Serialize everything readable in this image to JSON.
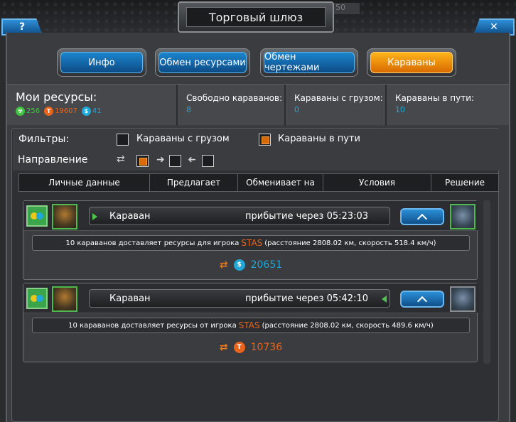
{
  "window": {
    "title": "Торговый шлюз",
    "clock": "50"
  },
  "buttons": {
    "help": "?",
    "close": "✕"
  },
  "tabs": [
    {
      "label": "Инфо",
      "active": false
    },
    {
      "label": "Обмен ресурсами",
      "active": false
    },
    {
      "label": "Обмен чертежами",
      "active": false
    },
    {
      "label": "Караваны",
      "active": true
    }
  ],
  "resources": {
    "title": "Мои ресурсы:",
    "items": [
      {
        "icon": "radiation-icon",
        "value": "256",
        "color": "#3fc23f"
      },
      {
        "icon": "titanium-icon",
        "value": "19607",
        "color": "#e8641c"
      },
      {
        "icon": "credits-icon",
        "value": "41",
        "color": "#1fa8d9"
      }
    ],
    "free_label": "Свободно караванов:",
    "free_value": "8",
    "loaded_label": "Караваны с грузом:",
    "loaded_value": "0",
    "transit_label": "Караваны в пути:",
    "transit_value": "10"
  },
  "filters": {
    "label": "Фильтры:",
    "loaded": {
      "label": "Караваны с грузом",
      "checked": false
    },
    "transit": {
      "label": "Караваны в пути",
      "checked": true
    },
    "direction_label": "Направление",
    "direction": {
      "both": true,
      "out": false,
      "in": false
    }
  },
  "table_headers": [
    "Личные данные",
    "Предлагает",
    "Обменивает на",
    "Условия",
    "Решение"
  ],
  "caravans": [
    {
      "name": "Караван",
      "eta": "прибытие через 05:23:03",
      "info_prefix": "10 караванов доставляет ресурсы для игрока",
      "player": "STAS",
      "info_suffix": "(расстояние 2808.02 км, скорость 518.4 км/ч)",
      "resource_icon": "credits-icon",
      "resource_color": "#1fa8d9",
      "amount": "20651"
    },
    {
      "name": "Караван",
      "eta": "прибытие через 05:42:10",
      "info_prefix": "10 караванов доставляет ресурсы от игрока",
      "player": "STAS",
      "info_suffix": "(расстояние 2808.02 км, скорость 489.6 км/ч)",
      "resource_icon": "titanium-icon",
      "resource_color": "#e8641c",
      "amount": "10736"
    }
  ]
}
